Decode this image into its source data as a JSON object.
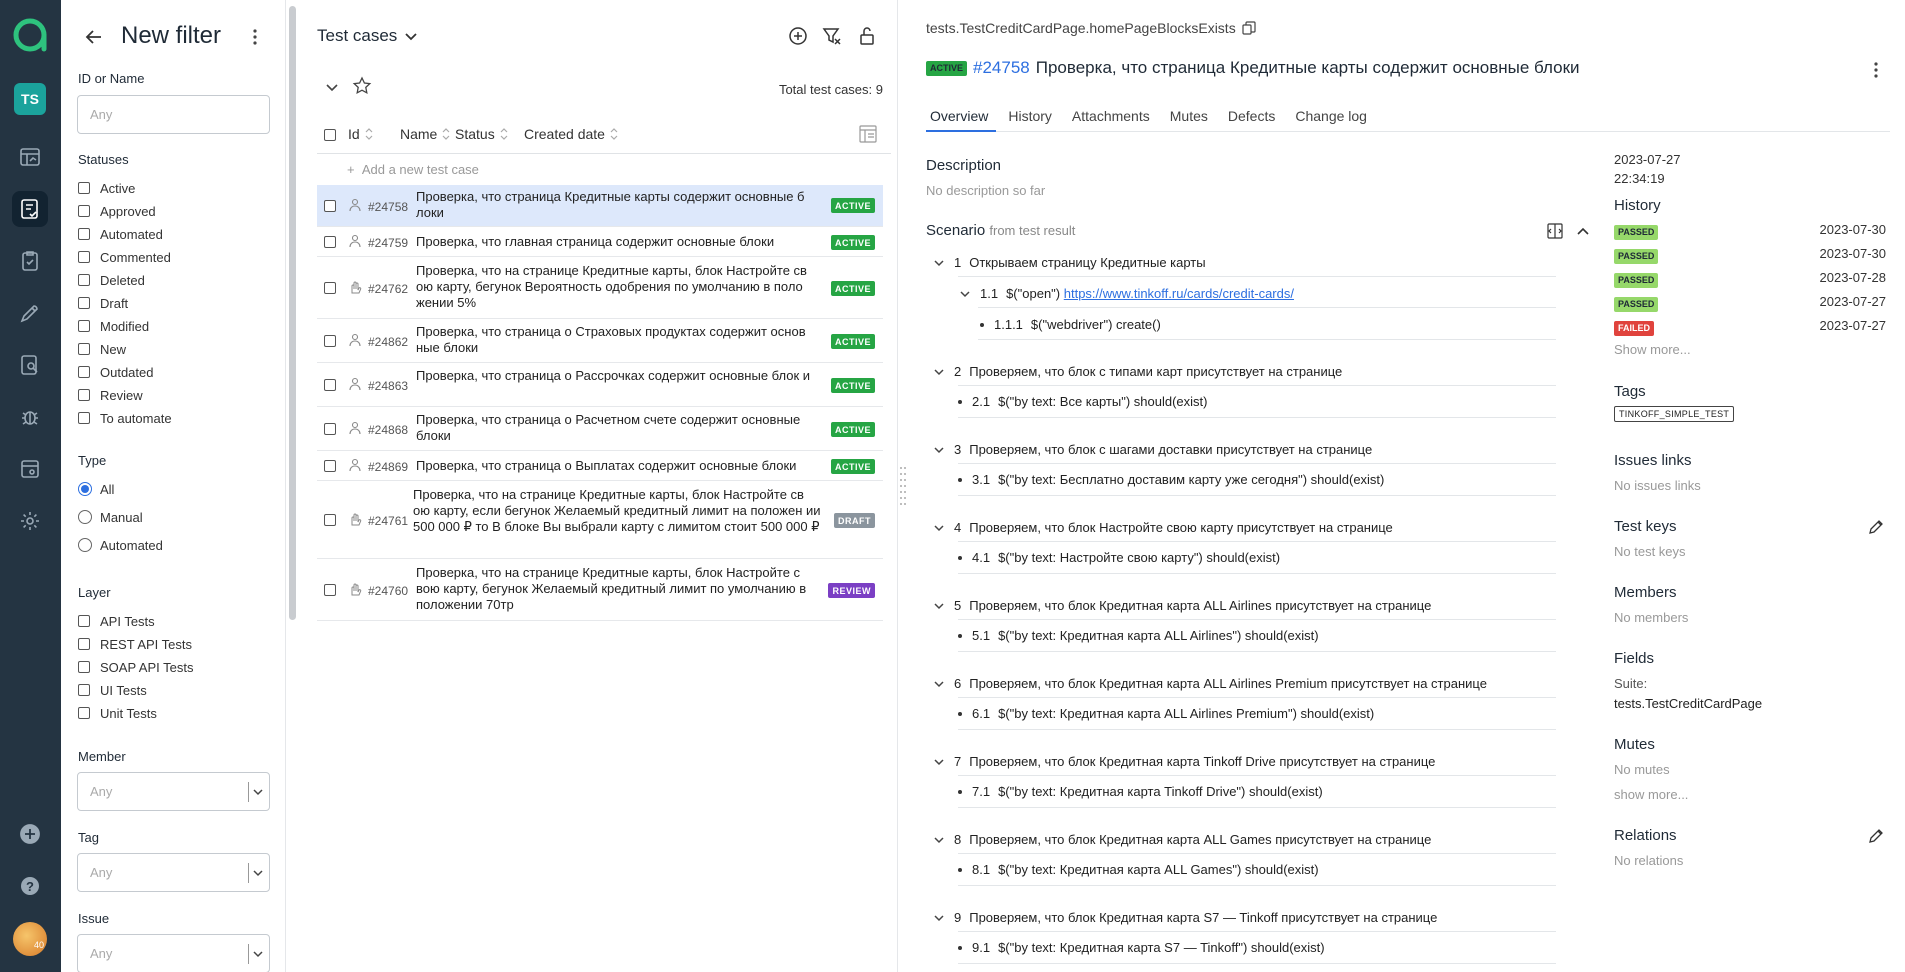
{
  "nav": {
    "avatar_initials": "TS",
    "avatar_badge": "40"
  },
  "filter": {
    "title": "New filter",
    "id_label": "ID or Name",
    "id_placeholder": "Any",
    "statuses_label": "Statuses",
    "statuses": [
      "Active",
      "Approved",
      "Automated",
      "Commented",
      "Deleted",
      "Draft",
      "Modified",
      "New",
      "Outdated",
      "Review",
      "To automate"
    ],
    "type_label": "Type",
    "types": [
      "All",
      "Manual",
      "Automated"
    ],
    "type_selected": "All",
    "layer_label": "Layer",
    "layers": [
      "API Tests",
      "REST API Tests",
      "SOAP API Tests",
      "UI Tests",
      "Unit Tests"
    ],
    "member_label": "Member",
    "member_value": "Any",
    "tag_label": "Tag",
    "tag_value": "Any",
    "issue_label": "Issue",
    "issue_value": "Any"
  },
  "list": {
    "title": "Test cases",
    "total": "Total test cases: 9",
    "columns": [
      "Id",
      "Name",
      "Status",
      "Created date"
    ],
    "add_placeholder": "Add a new test case",
    "rows": [
      {
        "id": "#24758",
        "name": "Проверка, что страница Кредитные карты содержит основные б локи",
        "status": "ACTIVE",
        "type": "auto"
      },
      {
        "id": "#24759",
        "name": "Проверка, что главная страница содержит основные блоки",
        "status": "ACTIVE",
        "type": "auto"
      },
      {
        "id": "#24762",
        "name": "Проверка, что на странице Кредитные карты, блок Настройте св ою карту, бегунок Вероятность одобрения по умолчанию в поло жении 5%",
        "status": "ACTIVE",
        "type": "manual"
      },
      {
        "id": "#24862",
        "name": "Проверка, что страница о Страховых продуктах содержит основ ные блоки",
        "status": "ACTIVE",
        "type": "auto"
      },
      {
        "id": "#24863",
        "name": "Проверка, что страница о Рассрочках содержит основные блок и",
        "status": "ACTIVE",
        "type": "auto"
      },
      {
        "id": "#24868",
        "name": "Проверка, что страница о Расчетном счете содержит основные блоки",
        "status": "ACTIVE",
        "type": "auto"
      },
      {
        "id": "#24869",
        "name": "Проверка, что страница о Выплатах содержит основные блоки",
        "status": "ACTIVE",
        "type": "auto"
      },
      {
        "id": "#24761",
        "name": "Проверка, что на странице Кредитные карты, блок Настройте св ою карту, если бегунок Желаемый кредитный лимит на положен ии 500 000 ₽ то В блоке Вы выбрали карту с лимитом стоит 500 000 ₽",
        "status": "DRAFT",
        "type": "manual"
      },
      {
        "id": "#24760",
        "name": "Проверка, что на странице Кредитные карты, блок Настройте с вою карту, бегунок Желаемый кредитный лимит по умолчанию в положении 70тр",
        "status": "REVIEW",
        "type": "manual"
      }
    ]
  },
  "detail": {
    "path": "tests.TestCreditCardPage.homePageBlocksExists",
    "status": "ACTIVE",
    "id": "#24758",
    "title": "Проверка, что страница Кредитные карты содержит основные блоки",
    "tabs": [
      "Overview",
      "History",
      "Attachments",
      "Mutes",
      "Defects",
      "Change log"
    ],
    "description_label": "Description",
    "description_text": "No description so far",
    "scenario_label": "Scenario",
    "scenario_from": "from test result",
    "steps": [
      {
        "n": "1",
        "text": "Открываем страницу Кредитные карты"
      },
      {
        "n": "1.1",
        "pre": "$(\"open\")",
        "link": "https://www.tinkoff.ru/cards/credit-cards/"
      },
      {
        "n": "1.1.1",
        "text": "$(\"webdriver\") create()"
      },
      {
        "n": "2",
        "text": "Проверяем, что блок с типами карт присутствует на странице"
      },
      {
        "n": "2.1",
        "text": "$(\"by text: Все карты\") should(exist)"
      },
      {
        "n": "3",
        "text": "Проверяем, что блок с шагами доставки присутствует на странице"
      },
      {
        "n": "3.1",
        "text": "$(\"by text: Бесплатно доставим карту уже сегодня\") should(exist)"
      },
      {
        "n": "4",
        "text": "Проверяем, что блок Настройте свою карту присутствует на странице"
      },
      {
        "n": "4.1",
        "text": "$(\"by text: Настройте свою карту\") should(exist)"
      },
      {
        "n": "5",
        "text": "Проверяем, что блок Кредитная карта ALL Airlines присутствует на странице"
      },
      {
        "n": "5.1",
        "text": "$(\"by text: Кредитная карта ALL Airlines\") should(exist)"
      },
      {
        "n": "6",
        "text": "Проверяем, что блок Кредитная карта ALL Airlines Premium присутствует на странице"
      },
      {
        "n": "6.1",
        "text": "$(\"by text: Кредитная карта ALL Airlines Premium\") should(exist)"
      },
      {
        "n": "7",
        "text": "Проверяем, что блок Кредитная карта Tinkoff Drive присутствует на странице"
      },
      {
        "n": "7.1",
        "text": "$(\"by text: Кредитная карта Tinkoff Drive\") should(exist)"
      },
      {
        "n": "8",
        "text": "Проверяем, что блок Кредитная карта ALL Games присутствует на странице"
      },
      {
        "n": "8.1",
        "text": "$(\"by text: Кредитная карта ALL Games\") should(exist)"
      },
      {
        "n": "9",
        "text": "Проверяем, что блок Кредитная карта S7 — Tinkoff присутствует на странице"
      },
      {
        "n": "9.1",
        "text": "$(\"by text: Кредитная карта S7 — Tinkoff\") should(exist)"
      }
    ]
  },
  "meta": {
    "date": "2023-07-27",
    "time": "22:34:19",
    "history_label": "History",
    "history": [
      {
        "status": "PASSED",
        "date": "2023-07-30"
      },
      {
        "status": "PASSED",
        "date": "2023-07-30"
      },
      {
        "status": "PASSED",
        "date": "2023-07-28"
      },
      {
        "status": "PASSED",
        "date": "2023-07-27"
      },
      {
        "status": "FAILED",
        "date": "2023-07-27"
      }
    ],
    "show_more": "Show more...",
    "tags_label": "Tags",
    "tag": "TINKOFF_SIMPLE_TEST",
    "issues_label": "Issues links",
    "issues_text": "No issues links",
    "testkeys_label": "Test keys",
    "testkeys_text": "No test keys",
    "members_label": "Members",
    "members_text": "No members",
    "fields_label": "Fields",
    "suite_label": "Suite:",
    "suite_value": "tests.TestCreditCardPage",
    "mutes_label": "Mutes",
    "mutes_text": "No mutes",
    "mutes_more": "show more...",
    "relations_label": "Relations",
    "relations_text": "No relations"
  },
  "colors": {
    "nav_bg": "#243442",
    "active_badge": "#26a544",
    "accent": "#2d6fe0",
    "review": "#7b3fc4",
    "passed": "#96d86a",
    "failed": "#e0433d"
  }
}
